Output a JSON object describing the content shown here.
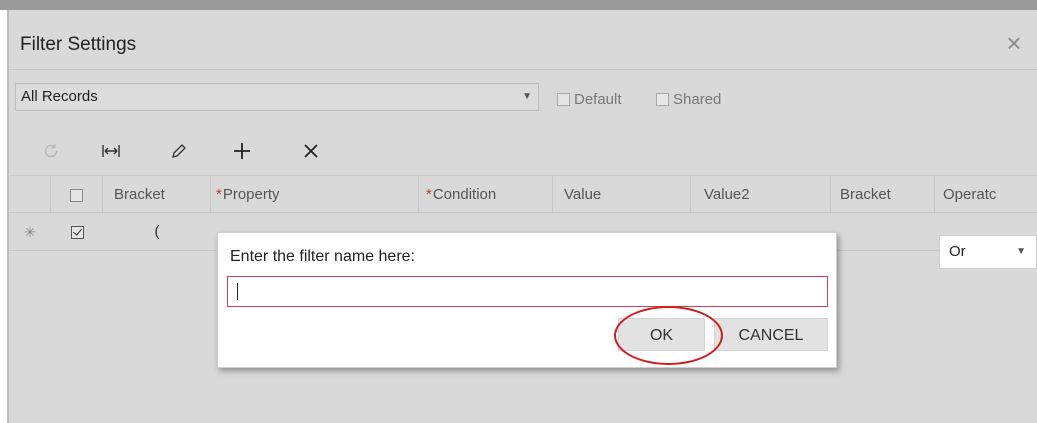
{
  "dialog_title": "Filter Settings",
  "filter_select": {
    "value": "All Records"
  },
  "checks": {
    "default_label": "Default",
    "shared_label": "Shared"
  },
  "toolbar": [
    "refresh-icon",
    "fit-columns-icon",
    "pencil-icon",
    "plus-icon",
    "delete-icon"
  ],
  "grid": {
    "columns": {
      "bracket": "Bracket",
      "property": "Property",
      "condition": "Condition",
      "value": "Value",
      "value2": "Value2",
      "bracket2": "Bracket",
      "operator": "Operatc"
    },
    "required_mark": "*",
    "row": {
      "new_marker": "✳",
      "open_bracket": "(",
      "operator": "Or",
      "checked": true
    }
  },
  "prompt": {
    "label": "Enter the filter name here:",
    "value": "",
    "ok_label": "OK",
    "cancel_label": "CANCEL"
  },
  "colors": {
    "panel_bg": "#d9d9d9",
    "input_border": "#d33c55",
    "highlight_ring": "#d41c1c"
  }
}
